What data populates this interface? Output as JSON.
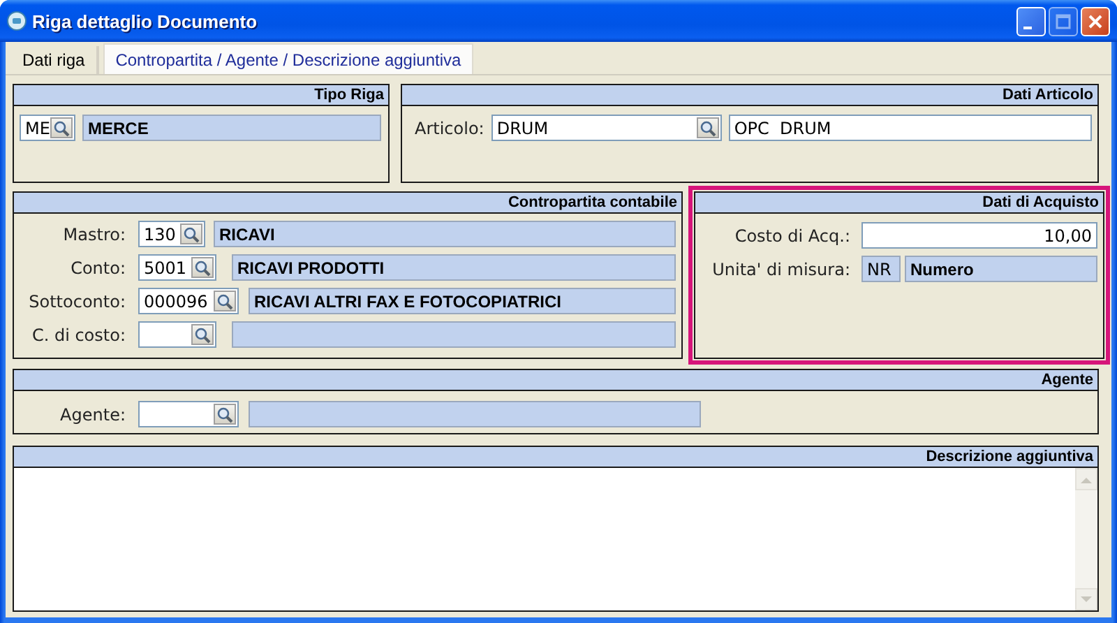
{
  "window": {
    "title": "Riga dettaglio Documento",
    "buttons": [
      {
        "kind": "minimize",
        "disabled": false
      },
      {
        "kind": "maximize",
        "disabled": true
      },
      {
        "kind": "close",
        "disabled": false
      }
    ]
  },
  "tabs": [
    {
      "label": "Dati riga",
      "selected": false
    },
    {
      "label": "Contropartita / Agente / Descrizione aggiuntiva",
      "selected": true
    }
  ],
  "tipo_riga": {
    "title": "Tipo Riga",
    "code": "ME",
    "description": "MERCE"
  },
  "dati_articolo": {
    "title": "Dati Articolo",
    "label": "Articolo:",
    "code": "DRUM",
    "description": "OPC  DRUM"
  },
  "contropartita": {
    "title": "Contropartita contabile",
    "rows": [
      {
        "label": "Mastro:",
        "code": "130",
        "description": "RICAVI"
      },
      {
        "label": "Conto:",
        "code": "5001",
        "description": "RICAVI PRODOTTI"
      },
      {
        "label": "Sottoconto:",
        "code": "000096",
        "description": "RICAVI ALTRI FAX E FOTOCOPIATRICI"
      },
      {
        "label": "C. di costo:"
      }
    ]
  },
  "dati_acquisto": {
    "title": "Dati di Acquisto",
    "highlighted": true,
    "costo": {
      "label": "Costo di Acq.:",
      "value": "10,00"
    },
    "unita": {
      "label": "Unita' di misura:",
      "code": "NR",
      "description": "Numero"
    }
  },
  "agente": {
    "title": "Agente",
    "label": "Agente:"
  },
  "descrizione": {
    "title": "Descrizione aggiuntiva"
  }
}
